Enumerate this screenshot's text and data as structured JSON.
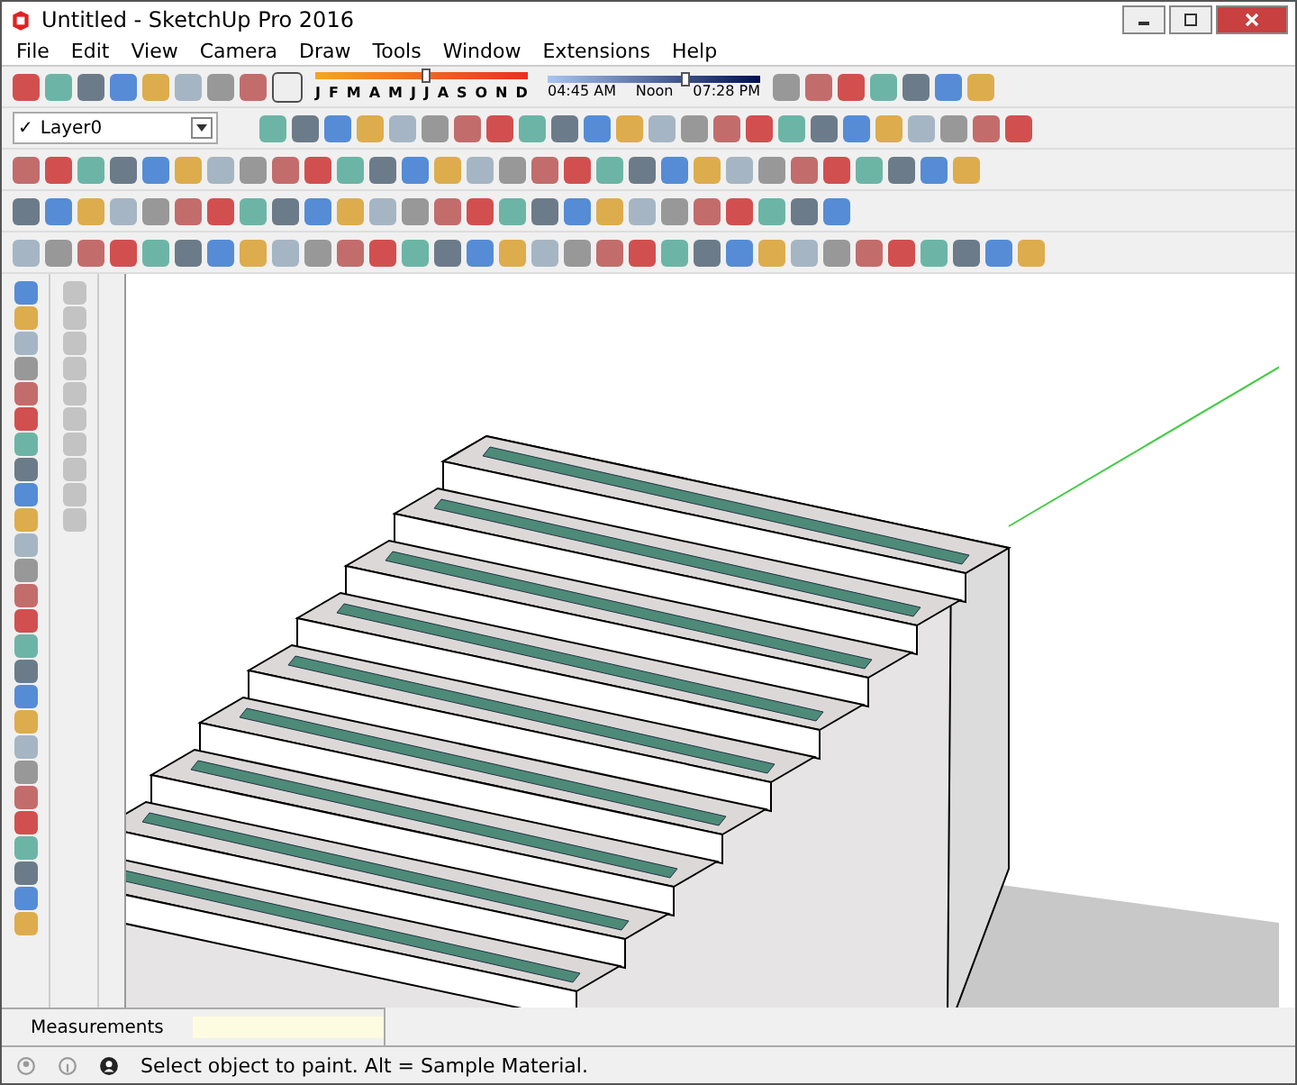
{
  "window": {
    "title": "Untitled - SketchUp Pro 2016"
  },
  "menu": [
    "File",
    "Edit",
    "View",
    "Camera",
    "Draw",
    "Tools",
    "Window",
    "Extensions",
    "Help"
  ],
  "shadow_date": {
    "months": [
      "J",
      "F",
      "M",
      "A",
      "M",
      "J",
      "J",
      "A",
      "S",
      "O",
      "N",
      "D"
    ],
    "level": 0.5
  },
  "shadow_time": {
    "start": "04:45 AM",
    "middle": "Noon",
    "end": "07:28 PM",
    "level": 0.63
  },
  "layer": {
    "check": "✓",
    "name": "Layer0"
  },
  "measurements": {
    "label": "Measurements"
  },
  "status_bar": {
    "message": "Select object to paint. Alt = Sample Material."
  }
}
